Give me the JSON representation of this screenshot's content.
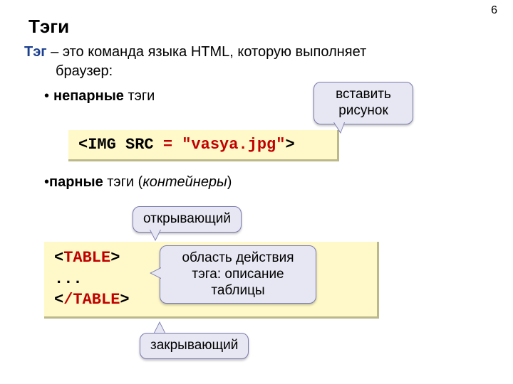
{
  "page_number": "6",
  "title": "Тэги",
  "definition": {
    "term": "Тэг",
    "text_after_term": " – это команда языка HTML, которую выполняет",
    "line2": "браузер:"
  },
  "bullet1": {
    "bold": "непарные",
    "rest": " тэги"
  },
  "code1": {
    "open": "<IMG SRC",
    "eq_red": " = \"vasya.jpg\"",
    "close": ">"
  },
  "bullet2": {
    "bold": "парные",
    "rest": " тэги (",
    "ital": "контейнеры",
    "rest2": ")"
  },
  "code2": {
    "l1a": "<",
    "l1red": "TABLE",
    "l1b": ">",
    "l2": "...",
    "l3a": "<",
    "l3slash_red": "/",
    "l3red": "TABLE",
    "l3b": ">"
  },
  "callouts": {
    "insert_picture_l1": "вставить",
    "insert_picture_l2": "рисунок",
    "opening": "открывающий",
    "scope_l1": "область действия",
    "scope_l2": "тэга: описание",
    "scope_l3": "таблицы",
    "closing": "закрывающий"
  }
}
